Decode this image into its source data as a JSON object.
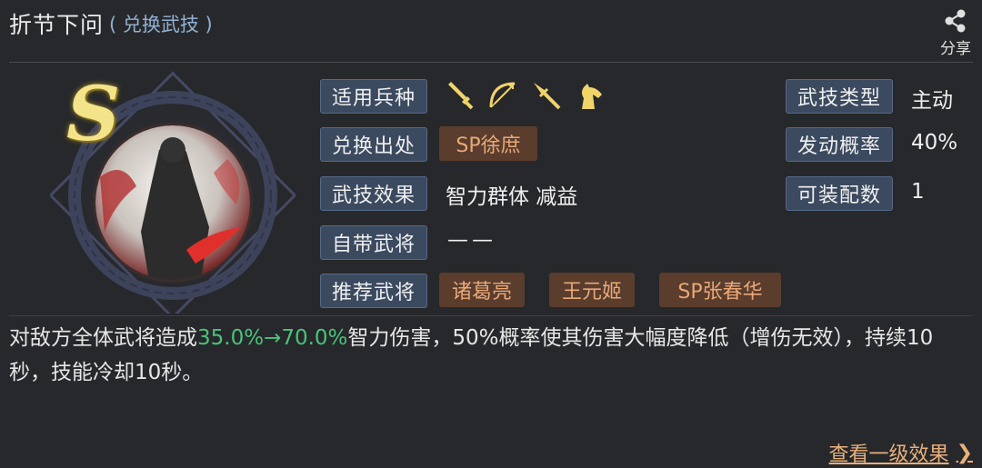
{
  "header": {
    "title": "折节下问",
    "subtitle": "( 兑换武技 )",
    "share_label": "分享"
  },
  "skill": {
    "grade": "S",
    "fields_left": [
      {
        "label": "适用兵种"
      },
      {
        "label": "兑换出处",
        "tag": "SP徐庶"
      },
      {
        "label": "武技效果",
        "value": "智力群体 减益"
      },
      {
        "label": "自带武将",
        "value": "——"
      },
      {
        "label": "推荐武将",
        "tags": [
          "诸葛亮",
          "王元姬",
          "SP张春华"
        ]
      }
    ],
    "troop_icons": [
      "sword-icon",
      "bow-icon",
      "spear-icon",
      "horse-icon"
    ],
    "fields_right": [
      {
        "label": "武技类型",
        "value": "主动"
      },
      {
        "label": "发动概率",
        "value": "40%"
      },
      {
        "label": "可装配数",
        "value": "1"
      }
    ]
  },
  "description": {
    "part1": "对敌方全体武将造成",
    "highlight": "35.0%→70.0%",
    "part2": "智力伤害，50%概率使其伤害大幅度降低（增伤无效），持续10秒，技能冷却10秒。"
  },
  "footer": {
    "link_label": "查看一级效果",
    "chevron": "❯"
  },
  "colors": {
    "background": "#27282b",
    "label_bg": "#3b4a5f",
    "tag_bg": "#5a3d2c",
    "tag_text": "#e8a879",
    "highlight_green": "#48c47a",
    "subtitle_blue": "#8fb1d3",
    "grade_gold": "#f3e48a"
  }
}
